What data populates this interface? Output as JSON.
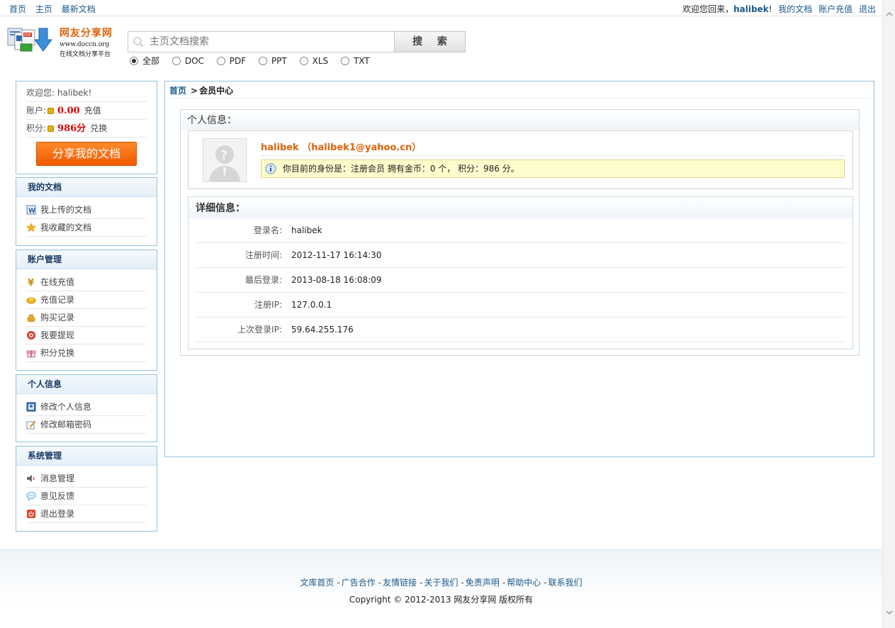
{
  "topnav": {
    "home": "首页",
    "main": "主页",
    "latest": "最新文档"
  },
  "topright": {
    "welcome": "欢迎您回来，",
    "username": "halibek",
    "excl": "!",
    "my_docs": "我的文档",
    "recharge": "账户充值",
    "logout": "退出"
  },
  "logo": {
    "title": "网友分享网",
    "url": "www.doccn.org",
    "slogan": "在线文档分享平台"
  },
  "search": {
    "placeholder": "主页文档搜索",
    "button": "搜 索",
    "types": [
      "全部",
      "DOC",
      "PDF",
      "PPT",
      "XLS",
      "TXT"
    ],
    "selected": "全部"
  },
  "account": {
    "welcome_label": "欢迎您:",
    "username": "halibek",
    "excl": "!",
    "balance_label": "账户:",
    "balance": "0.00",
    "recharge": "充值",
    "points_label": "积分:",
    "points": "986分",
    "exchange": "兑换",
    "share_button": "分享我的文档"
  },
  "sidebar": {
    "my_docs": {
      "title": "我的文档",
      "items": [
        "我上传的文档",
        "我收藏的文档"
      ]
    },
    "account_mgmt": {
      "title": "账户管理",
      "items": [
        "在线充值",
        "充值记录",
        "购买记录",
        "我要提现",
        "积分兑换"
      ]
    },
    "personal": {
      "title": "个人信息",
      "items": [
        "修改个人信息",
        "修改邮箱密码"
      ]
    },
    "system": {
      "title": "系统管理",
      "items": [
        "消息管理",
        "意见反馈",
        "退出登录"
      ]
    }
  },
  "breadcrumb": {
    "home": "首页",
    "sep": ">",
    "current": "会员中心"
  },
  "profile": {
    "section_title": "个人信息：",
    "name_line": "halibek （halibek1@yahoo.cn）",
    "notice": "你目前的身份是：注册会员  拥有金币：0 个，  积分：986 分。"
  },
  "details": {
    "title": "详细信息：",
    "rows": [
      {
        "label": "登录名:",
        "value": "halibek"
      },
      {
        "label": "注册时间:",
        "value": "2012-11-17 16:14:30"
      },
      {
        "label": "最后登录:",
        "value": "2013-08-18 16:08:09"
      },
      {
        "label": "注册IP:",
        "value": "127.0.0.1"
      },
      {
        "label": "上次登录IP:",
        "value": "59.64.255.176"
      }
    ]
  },
  "footer": {
    "links": [
      "文库首页",
      "广告合作",
      "友情链接",
      "关于我们",
      "免责声明",
      "帮助中心",
      "联系我们"
    ],
    "dash": "-",
    "copyright": "Copyright © 2012-2013 网友分享网  版权所有"
  },
  "colors": {
    "accent_orange": "#e0620b",
    "link_blue": "#1a5a8c",
    "panel_border": "#8fc2e2",
    "money_red": "#d90000"
  }
}
